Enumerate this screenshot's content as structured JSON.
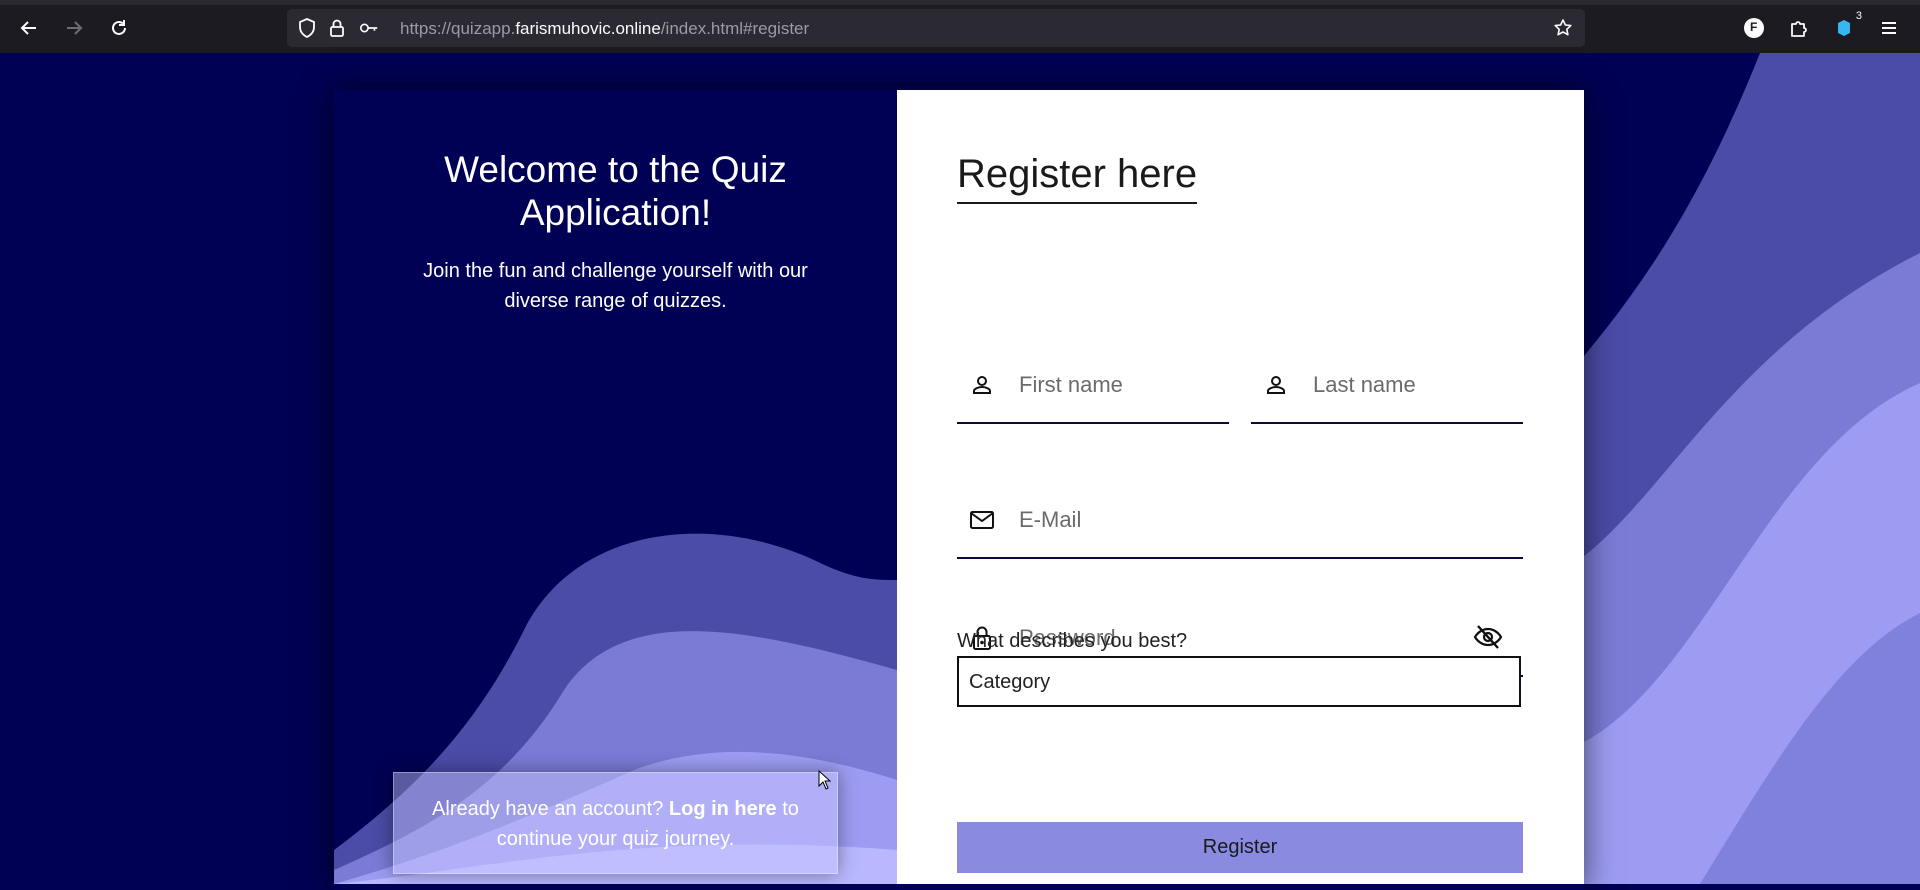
{
  "browser": {
    "url_prefix": "https://quizapp.",
    "url_domain": "farismuhovic.online",
    "url_path": "/index.html#register",
    "extensions_badge": "3",
    "profile_initial": "F"
  },
  "left": {
    "welcome_title": "Welcome to the Quiz Application!",
    "welcome_subtitle": "Join the fun and challenge yourself with our diverse range of quizzes.",
    "login_prefix": "Already have an account?",
    "login_link": "Log in here",
    "login_suffix": "to continue your quiz journey."
  },
  "form": {
    "title": "Register here",
    "first_name_placeholder": "First name",
    "last_name_placeholder": "Last name",
    "email_placeholder": "E-Mail",
    "password_placeholder": "Password",
    "category_label": "What describes you best?",
    "category_value": "Category",
    "register_label": "Register"
  },
  "colors": {
    "page_bg": "#000054",
    "wave_1": "#4b4ba8",
    "wave_2": "#7b7bd6",
    "wave_3": "#9d9cf2",
    "wave_4": "#b9b8ff",
    "button": "#8a8be0"
  }
}
